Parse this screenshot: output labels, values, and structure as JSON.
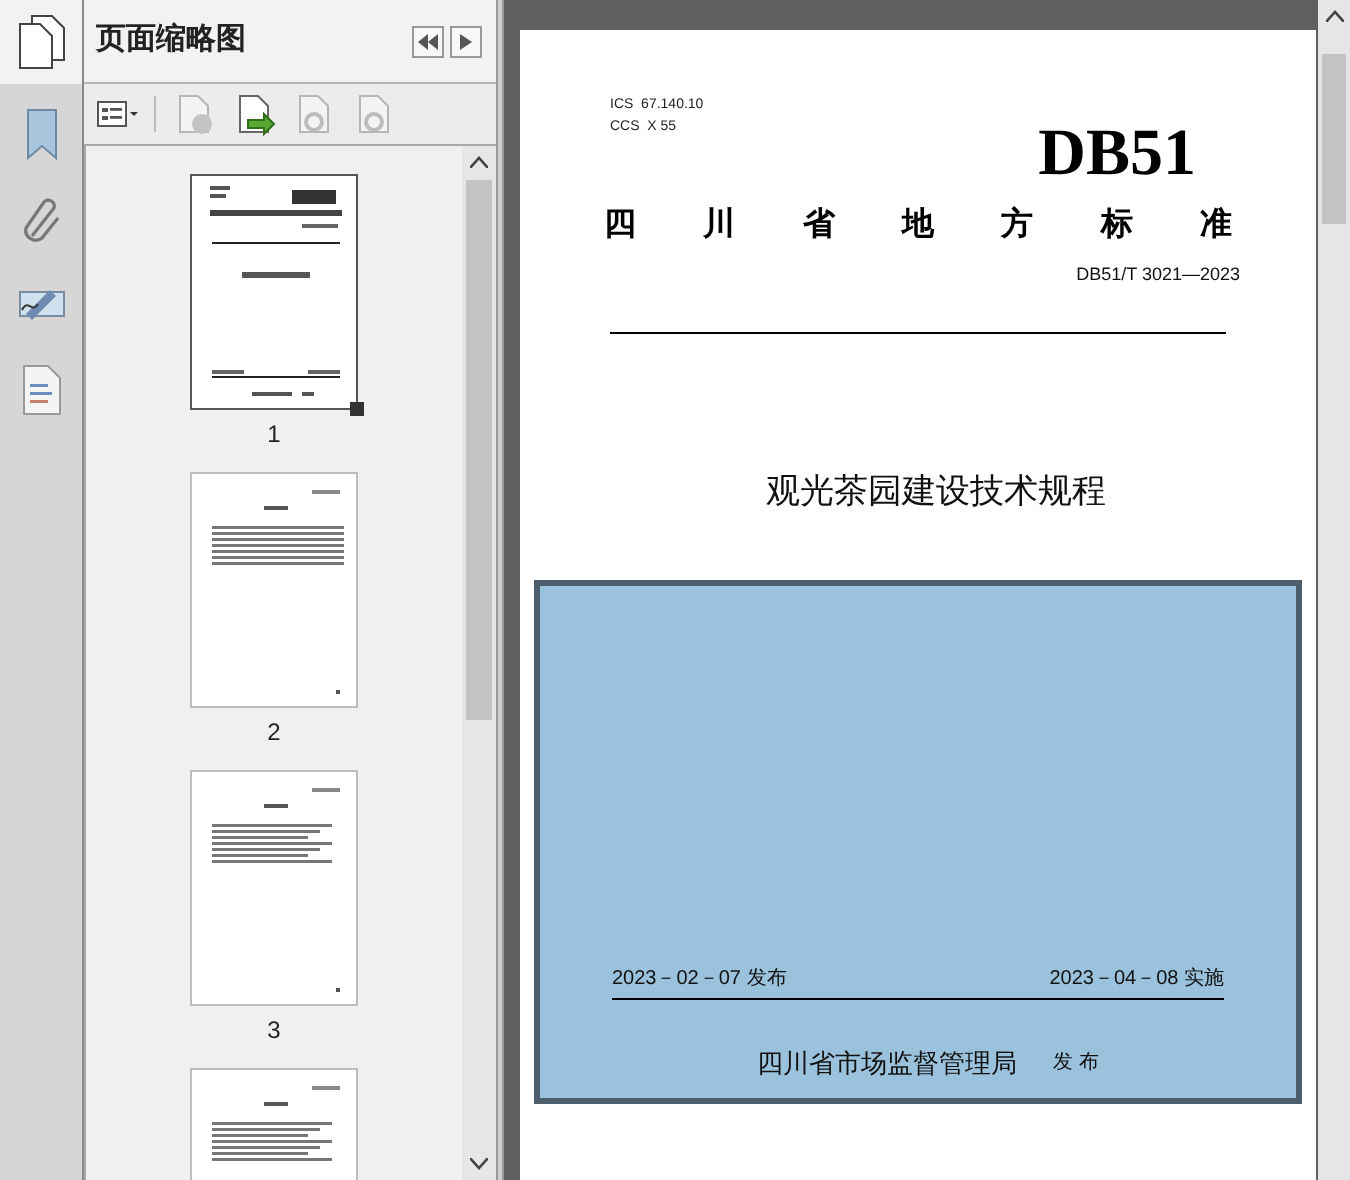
{
  "panel": {
    "title": "页面缩略图"
  },
  "thumbnails": [
    {
      "label": "1",
      "selected": true
    },
    {
      "label": "2",
      "selected": false
    },
    {
      "label": "3",
      "selected": false
    },
    {
      "selected": false
    }
  ],
  "document": {
    "ics": "ICS  67.140.10",
    "ccs": "CCS  X 55",
    "code": "DB51",
    "category": [
      "四",
      "川",
      "省",
      "地",
      "方",
      "标",
      "准"
    ],
    "number": "DB51/T 3021—2023",
    "title": "观光茶园建设技术规程",
    "publish_date": "2023－02－07 发布",
    "effective_date": "2023－04－08 实施",
    "issuer": "四川省市场监督管理局",
    "issue_word": "发 布"
  }
}
